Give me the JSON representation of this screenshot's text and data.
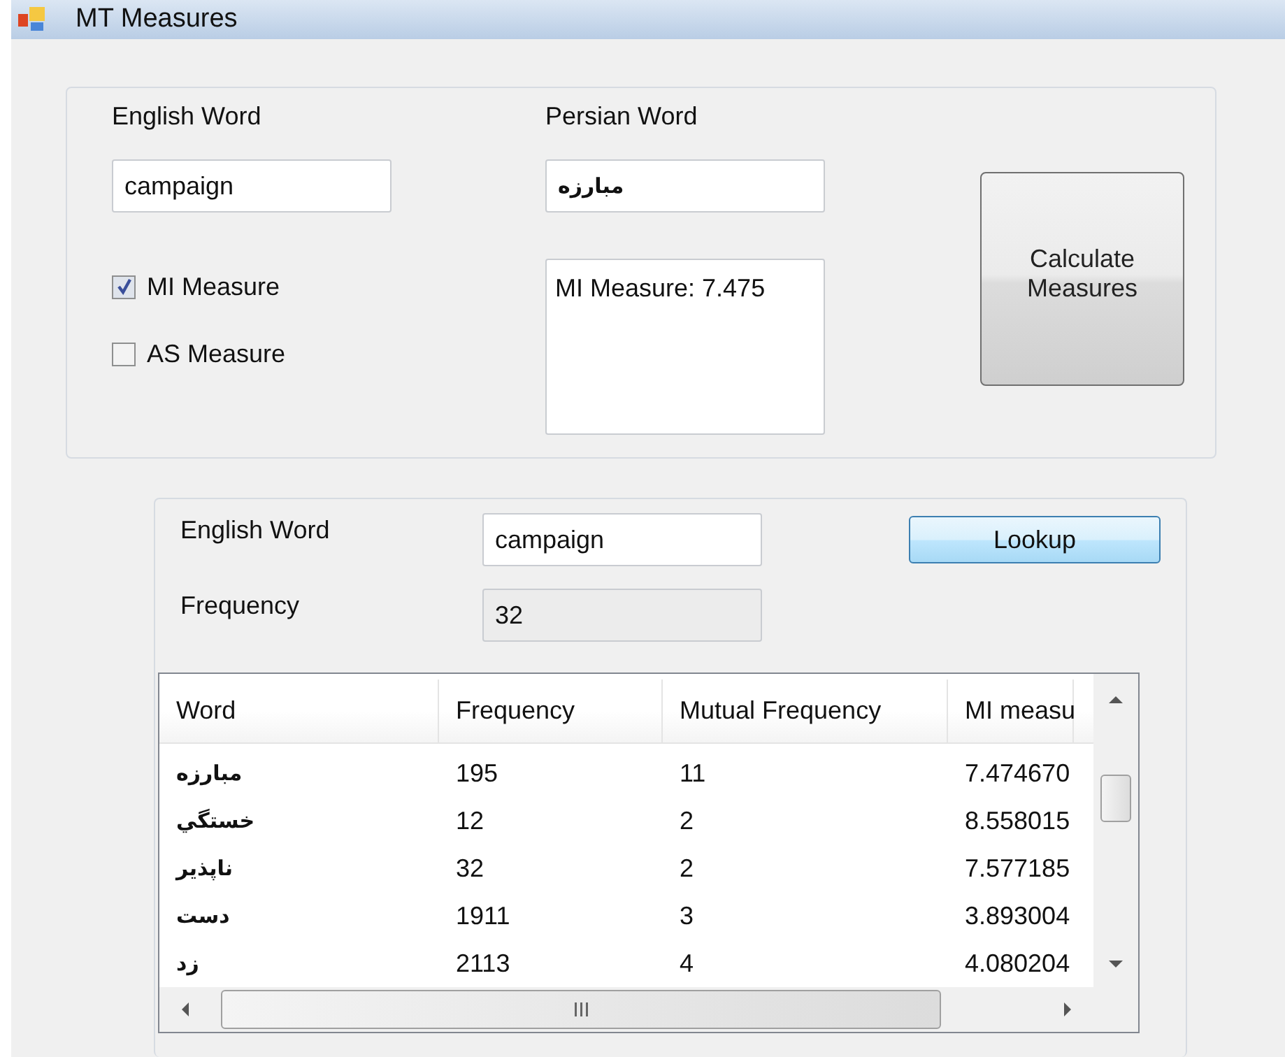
{
  "window": {
    "title": "MT Measures"
  },
  "measures_group": {
    "english_label": "English Word",
    "english_value": "campaign",
    "persian_label": "Persian Word",
    "persian_value": "مبارزه",
    "options": [
      {
        "label": "MI Measure",
        "checked": true
      },
      {
        "label": "AS Measure",
        "checked": false
      }
    ],
    "result": "MI Measure: 7.475",
    "calculate_button": "Calculate Measures"
  },
  "lookup_group": {
    "english_label": "English Word",
    "english_value": "campaign",
    "lookup_button": "Lookup",
    "frequency_label": "Frequency",
    "frequency_value": "32",
    "table": {
      "columns": [
        "Word",
        "Frequency",
        "Mutual Frequency",
        "MI measu"
      ],
      "rows": [
        [
          "مبارزه",
          "195",
          "11",
          "7.474670"
        ],
        [
          "خستگي",
          "12",
          "2",
          "8.558015"
        ],
        [
          "ناپذير",
          "32",
          "2",
          "7.577185"
        ],
        [
          "دست",
          "1911",
          "3",
          "3.893004"
        ],
        [
          "زد",
          "2113",
          "4",
          "4.080204"
        ]
      ]
    }
  }
}
